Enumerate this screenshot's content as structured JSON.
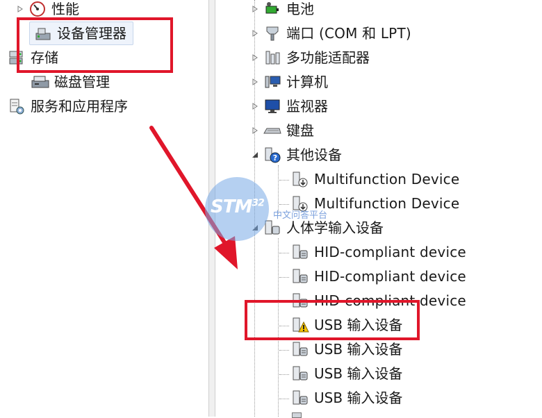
{
  "left_tree": {
    "performance": "性能",
    "device_manager": "设备管理器",
    "storage": "存储",
    "disk_management": "磁盘管理",
    "services_apps": "服务和应用程序"
  },
  "device_tree": {
    "battery": "电池",
    "ports": "端口 (COM 和 LPT)",
    "multifunction_adapters": "多功能适配器",
    "computer": "计算机",
    "monitors": "监视器",
    "keyboard": "键盘",
    "other_devices": "其他设备",
    "multifunction_device_1": "Multifunction Device",
    "multifunction_device_2": "Multifunction Device",
    "hid": "人体学输入设备",
    "hid_device_1": "HID-compliant device",
    "hid_device_2": "HID-compliant device",
    "hid_device_3": "HID-compliant device",
    "usb_input_warning": "USB 输入设备",
    "usb_input_1": "USB 输入设备",
    "usb_input_2": "USB 输入设备",
    "usb_input_3": "USB 输入设备"
  },
  "watermark": {
    "logo": "STM",
    "logo_num": "32",
    "subtitle": "中文问答平台"
  },
  "colors": {
    "annotation_red": "#e0162a",
    "selection_bg": "#eef3fb",
    "warning_yellow": "#f5c400"
  }
}
